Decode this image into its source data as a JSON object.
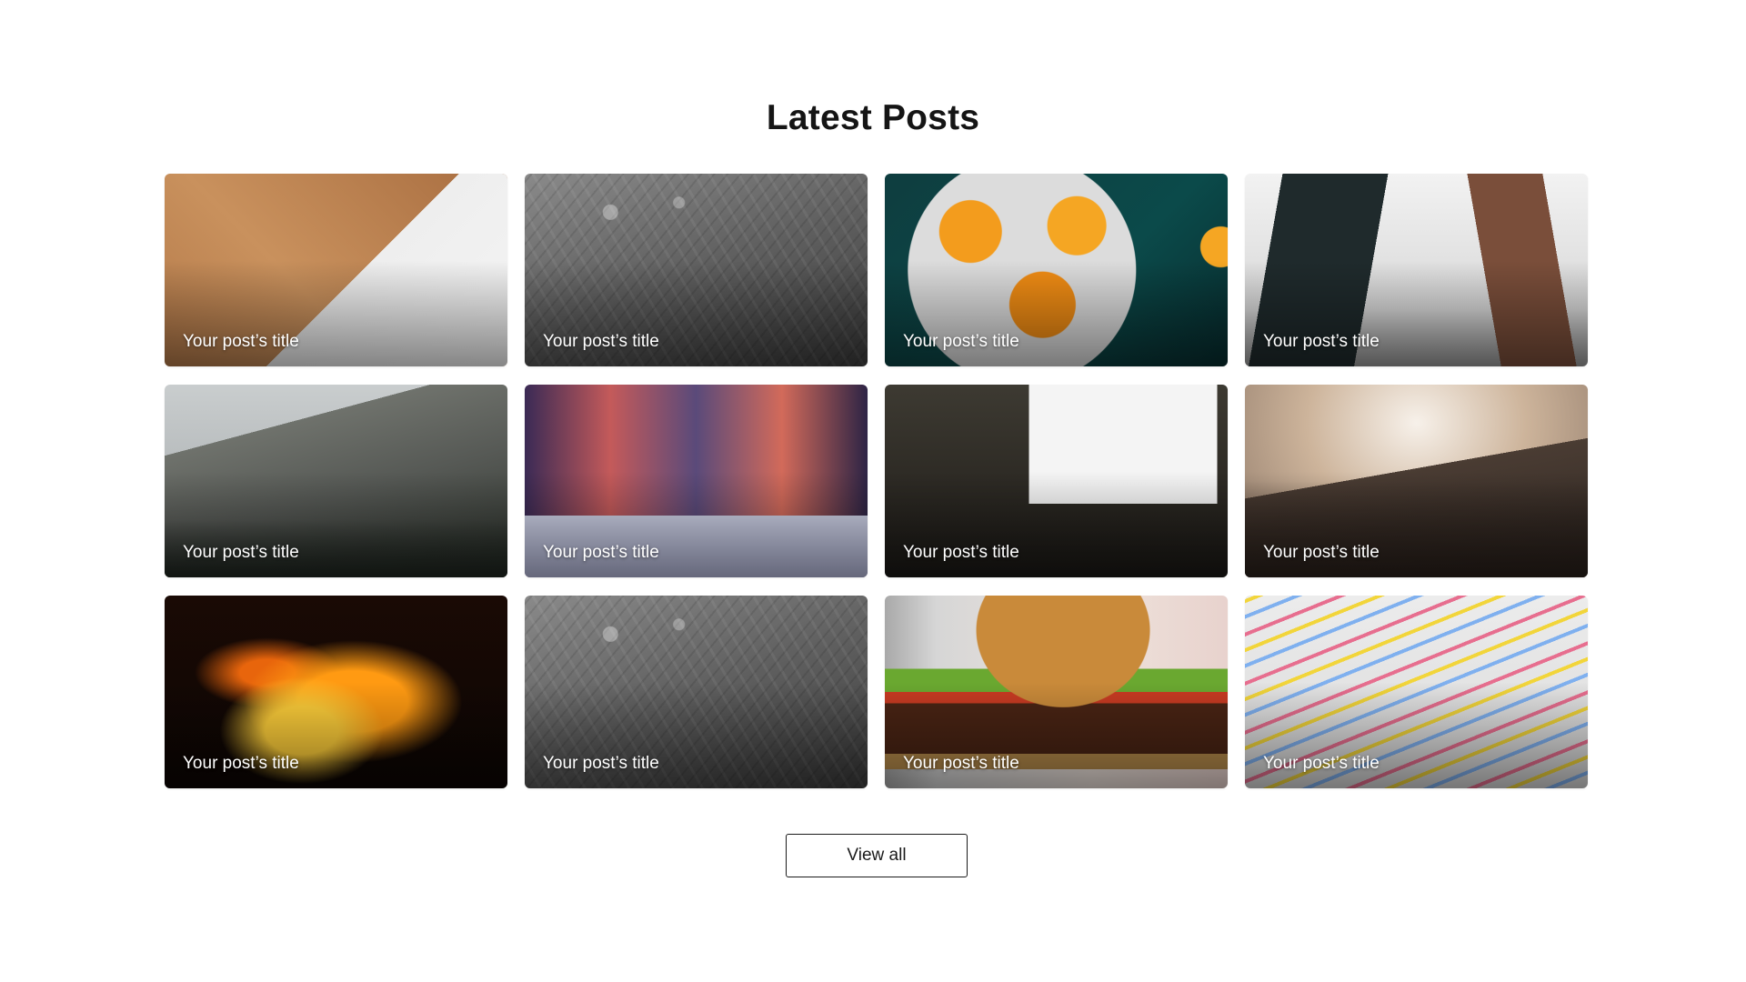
{
  "section": {
    "title": "Latest Posts",
    "view_all_label": "View all"
  },
  "posts": [
    {
      "title": "Your post’s title",
      "image": "accessories-photo"
    },
    {
      "title": "Your post’s title",
      "image": "frosted-glass-photo"
    },
    {
      "title": "Your post’s title",
      "image": "oranges-photo"
    },
    {
      "title": "Your post’s title",
      "image": "phone-watch-photo"
    },
    {
      "title": "Your post’s title",
      "image": "mountain-photo"
    },
    {
      "title": "Your post’s title",
      "image": "desk-setup-photo"
    },
    {
      "title": "Your post’s title",
      "image": "computer-desk-photo"
    },
    {
      "title": "Your post’s title",
      "image": "valley-sunset-photo"
    },
    {
      "title": "Your post’s title",
      "image": "fire-photo"
    },
    {
      "title": "Your post’s title",
      "image": "frosted-glass-photo"
    },
    {
      "title": "Your post’s title",
      "image": "burger-photo"
    },
    {
      "title": "Your post’s title",
      "image": "pencils-photo"
    }
  ]
}
